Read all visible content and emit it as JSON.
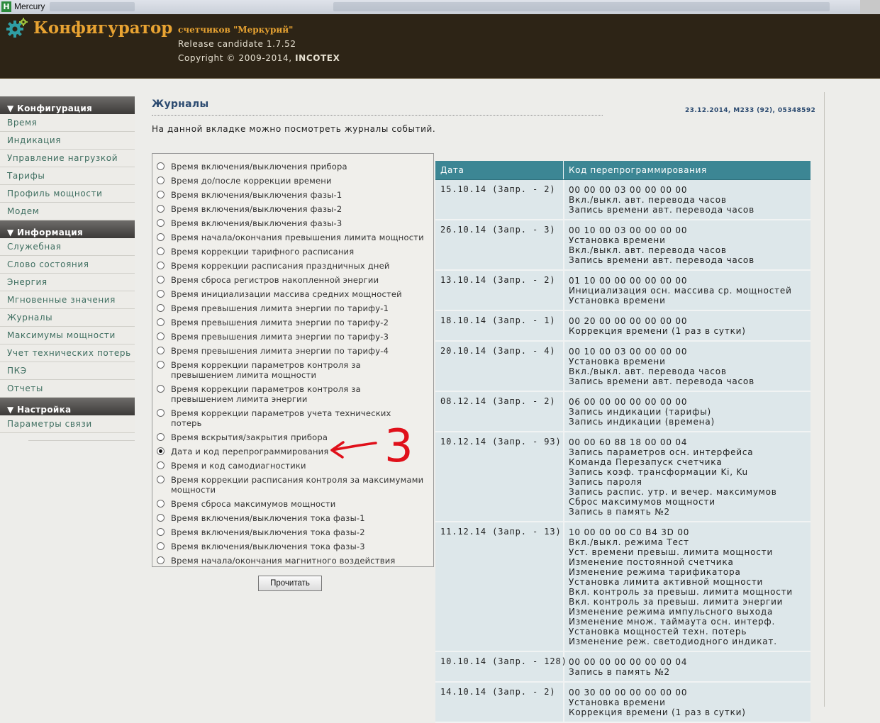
{
  "window": {
    "title": "Mercury",
    "app_icon_letter": "H"
  },
  "header": {
    "title": "Конфигуратор",
    "subtitle": "счетчиков \"Меркурий\"",
    "release": "Release candidate 1.7.52",
    "copyright": "Copyright © 2009-2014,",
    "company": "INCOTEX",
    "title_color": "#e8a332",
    "background": "#2d2416"
  },
  "sidebar": {
    "sections": [
      {
        "title": "Конфигурация",
        "items": [
          "Время",
          "Индикация",
          "Управление нагрузкой",
          "Тарифы",
          "Профиль мощности",
          "Модем"
        ]
      },
      {
        "title": "Информация",
        "items": [
          "Служебная",
          "Слово состояния",
          "Энергия",
          "Мгновенные значения",
          "Журналы",
          "Максимумы мощности",
          "Учет технических потерь",
          "ПКЭ",
          "Отчеты"
        ]
      },
      {
        "title": "Настройка",
        "items": [
          "Параметры связи"
        ]
      }
    ]
  },
  "main": {
    "title": "Журналы",
    "meter_info": "23.12.2014, M233 (92), 05348592",
    "intro": "На данной вкладке можно посмотреть журналы событий.",
    "read_button": "Прочитать",
    "annotation_number": "3",
    "options": [
      {
        "label": "Время включения/выключения прибора"
      },
      {
        "label": "Время до/после коррекции времени"
      },
      {
        "label": "Время включения/выключения фазы-1"
      },
      {
        "label": "Время включения/выключения фазы-2"
      },
      {
        "label": "Время включения/выключения фазы-3"
      },
      {
        "label": "Время начала/окончания превышения лимита мощности"
      },
      {
        "label": "Время коррекции тарифного расписания"
      },
      {
        "label": "Время коррекции расписания праздничных дней"
      },
      {
        "label": "Время сброса регистров накопленной энергии"
      },
      {
        "label": "Время инициализации массива средних мощностей"
      },
      {
        "label": "Время превышения лимита энергии по тарифу-1"
      },
      {
        "label": "Время превышения лимита энергии по тарифу-2"
      },
      {
        "label": "Время превышения лимита энергии по тарифу-3"
      },
      {
        "label": "Время превышения лимита энергии по тарифу-4"
      },
      {
        "label": "Время коррекции параметров контроля за",
        "label2": "превышением лимита мощности"
      },
      {
        "label": "Время коррекции параметров контроля за",
        "label2": "превышением лимита энергии"
      },
      {
        "label": "Время коррекции параметров учета технических",
        "label2": "потерь"
      },
      {
        "label": "Время вскрытия/закрытия прибора"
      },
      {
        "label": "Дата и код перепрограммирования",
        "selected": true
      },
      {
        "label": "Время и код самодиагностики"
      },
      {
        "label": "Время коррекции расписания контроля за максимумами",
        "label2": "мощности"
      },
      {
        "label": "Время сброса максимумов мощности"
      },
      {
        "label": "Время включения/выключения тока фазы-1"
      },
      {
        "label": "Время включения/выключения тока фазы-2"
      },
      {
        "label": "Время включения/выключения тока фазы-3"
      },
      {
        "label": "Время начала/окончания магнитного воздействия"
      }
    ],
    "table": {
      "headers": [
        "Дата",
        "Код перепрограммирования"
      ],
      "header_color": "#3c8694",
      "rows": [
        {
          "date": "15.10.14 (Запр. - 2)",
          "lines": [
            "00 00 00 03 00 00 00 00",
            "Вкл./выкл. авт. перевода часов",
            "Запись времени авт. перевода часов"
          ]
        },
        {
          "date": "26.10.14 (Запр. - 3)",
          "lines": [
            "00 10 00 03 00 00 00 00",
            "Установка времени",
            "Вкл./выкл. авт. перевода часов",
            "Запись времени авт. перевода часов"
          ]
        },
        {
          "date": "13.10.14 (Запр. - 2)",
          "lines": [
            "01 10 00 00 00 00 00 00",
            "Инициализация осн. массива ср. мощностей",
            "Установка времени"
          ]
        },
        {
          "date": "18.10.14 (Запр. - 1)",
          "lines": [
            "00 20 00 00 00 00 00 00",
            "Коррекция времени (1 раз в сутки)"
          ]
        },
        {
          "date": "20.10.14 (Запр. - 4)",
          "lines": [
            "00 10 00 03 00 00 00 00",
            "Установка времени",
            "Вкл./выкл. авт. перевода часов",
            "Запись времени авт. перевода часов"
          ]
        },
        {
          "date": "08.12.14 (Запр. - 2)",
          "lines": [
            "06 00 00 00 00 00 00 00",
            "Запись индикации (тарифы)",
            "Запись индикации (времена)"
          ]
        },
        {
          "date": "10.12.14 (Запр. - 93)",
          "lines": [
            "00 00 60 88 18 00 00 04",
            "Запись параметров осн. интерфейса",
            "Команда Перезапуск счетчика",
            "Запись коэф. трансформации Ki, Ku",
            "Запись пароля",
            "Запись распис. утр. и вечер. максимумов",
            "Сброс максимумов мощности",
            "Запись в память №2"
          ]
        },
        {
          "date": "11.12.14 (Запр. - 13)",
          "lines": [
            "10 00 00 00 C0 B4 3D 00",
            "Вкл./выкл. режима Тест",
            "Уст. времени превыш. лимита мощности",
            "Изменение постоянной счетчика",
            "Изменение режима тарификатора",
            "Установка лимита активной мощности",
            "Вкл. контроль за превыш. лимита мощности",
            "Вкл. контроль за превыш. лимита энергии",
            "Изменение режима импульсного выхода",
            "Изменение множ. таймаута осн. интерф.",
            "Установка мощностей техн. потерь",
            "Изменение реж. светодиодного индикат."
          ]
        },
        {
          "date": "10.10.14 (Запр. - 128)",
          "lines": [
            "00 00 00 00 00 00 00 04",
            "Запись в память №2"
          ]
        },
        {
          "date": "14.10.14 (Запр. - 2)",
          "lines": [
            "00 30 00 00 00 00 00 00",
            "Установка времени",
            "Коррекция времени (1 раз в сутки)"
          ]
        }
      ]
    }
  }
}
